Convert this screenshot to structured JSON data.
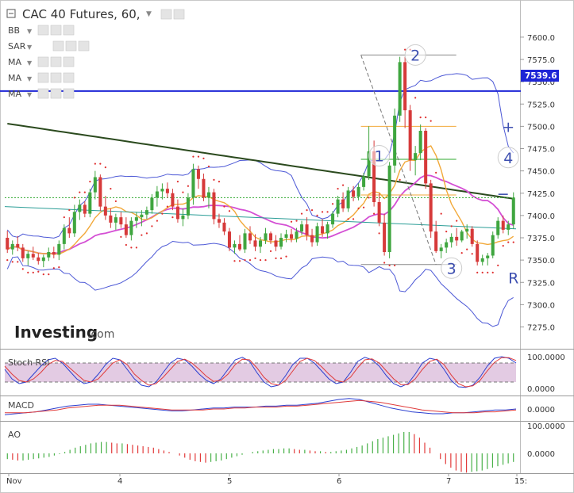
{
  "title": "CAC 40 Futures, 60,",
  "indicators": [
    "BB",
    "SAR",
    "MA",
    "MA",
    "MA"
  ],
  "logo": {
    "main": "Investing",
    "suffix": ".com"
  },
  "colors": {
    "up": "#3fa63f",
    "down": "#d63a3a",
    "bb": "#4c58d6",
    "ma_long": "#2b4a1e",
    "ma_mid": "#d44fd4",
    "ma_short": "#f2a93a",
    "hline": "#1d25d6",
    "support": "#2a9d96",
    "sar": "#e03030",
    "stoch_band": "#e3cbe3",
    "macd_line": "#2b3fd0",
    "signal_line": "#e03b3b",
    "ao_up": "#49b149",
    "ao_down": "#e23a3a"
  },
  "chart_data": [
    {
      "type": "candlestick",
      "title": "CAC 40 Futures, 60,",
      "y_ticks": [
        7600.0,
        7575.0,
        7550.0,
        7525.0,
        7500.0,
        7475.0,
        7450.0,
        7425.0,
        7400.0,
        7375.0,
        7350.0,
        7325.0,
        7300.0,
        7275.0
      ],
      "ylim": [
        7255,
        7615
      ],
      "x_ticks": [
        "Nov",
        "4",
        "5",
        "6",
        "7",
        "15:"
      ],
      "horizontal_line": {
        "value": 7539.6,
        "label": "7539.6"
      },
      "annotations": [
        "1",
        "2",
        "3",
        "+",
        "4",
        "−",
        "R"
      ],
      "candles": [
        [
          7375,
          7383,
          7358,
          7362
        ],
        [
          7362,
          7372,
          7356,
          7368
        ],
        [
          7368,
          7377,
          7360,
          7364
        ],
        [
          7364,
          7368,
          7348,
          7352
        ],
        [
          7352,
          7360,
          7344,
          7357
        ],
        [
          7357,
          7365,
          7350,
          7353
        ],
        [
          7353,
          7358,
          7345,
          7349
        ],
        [
          7349,
          7356,
          7342,
          7353
        ],
        [
          7353,
          7364,
          7349,
          7359
        ],
        [
          7359,
          7365,
          7352,
          7356
        ],
        [
          7356,
          7372,
          7350,
          7368
        ],
        [
          7368,
          7390,
          7362,
          7386
        ],
        [
          7386,
          7398,
          7375,
          7380
        ],
        [
          7380,
          7412,
          7376,
          7404
        ],
        [
          7404,
          7418,
          7395,
          7412
        ],
        [
          7412,
          7416,
          7398,
          7402
        ],
        [
          7402,
          7430,
          7398,
          7426
        ],
        [
          7426,
          7450,
          7418,
          7443
        ],
        [
          7443,
          7446,
          7405,
          7410
        ],
        [
          7410,
          7422,
          7395,
          7400
        ],
        [
          7400,
          7408,
          7386,
          7392
        ],
        [
          7392,
          7402,
          7384,
          7398
        ],
        [
          7398,
          7404,
          7386,
          7390
        ],
        [
          7390,
          7398,
          7375,
          7378
        ],
        [
          7378,
          7398,
          7372,
          7394
        ],
        [
          7394,
          7404,
          7386,
          7398
        ],
        [
          7398,
          7406,
          7388,
          7401
        ],
        [
          7401,
          7410,
          7396,
          7406
        ],
        [
          7406,
          7424,
          7402,
          7420
        ],
        [
          7420,
          7433,
          7410,
          7427
        ],
        [
          7427,
          7436,
          7418,
          7430
        ],
        [
          7430,
          7437,
          7420,
          7425
        ],
        [
          7425,
          7430,
          7406,
          7410
        ],
        [
          7410,
          7418,
          7392,
          7396
        ],
        [
          7396,
          7408,
          7388,
          7400
        ],
        [
          7400,
          7425,
          7396,
          7420
        ],
        [
          7420,
          7458,
          7412,
          7452
        ],
        [
          7452,
          7456,
          7430,
          7441
        ],
        [
          7441,
          7447,
          7416,
          7420
        ],
        [
          7420,
          7432,
          7408,
          7426
        ],
        [
          7426,
          7430,
          7390,
          7396
        ],
        [
          7396,
          7402,
          7386,
          7392
        ],
        [
          7392,
          7397,
          7378,
          7382
        ],
        [
          7382,
          7386,
          7360,
          7364
        ],
        [
          7364,
          7372,
          7357,
          7368
        ],
        [
          7368,
          7378,
          7360,
          7362
        ],
        [
          7362,
          7385,
          7358,
          7380
        ],
        [
          7380,
          7388,
          7368,
          7372
        ],
        [
          7372,
          7379,
          7360,
          7365
        ],
        [
          7365,
          7376,
          7358,
          7372
        ],
        [
          7372,
          7386,
          7368,
          7380
        ],
        [
          7380,
          7382,
          7368,
          7372
        ],
        [
          7372,
          7378,
          7360,
          7365
        ],
        [
          7365,
          7380,
          7362,
          7375
        ],
        [
          7375,
          7384,
          7370,
          7379
        ],
        [
          7379,
          7385,
          7370,
          7374
        ],
        [
          7374,
          7386,
          7370,
          7382
        ],
        [
          7382,
          7394,
          7378,
          7390
        ],
        [
          7390,
          7398,
          7372,
          7378
        ],
        [
          7378,
          7385,
          7365,
          7370
        ],
        [
          7370,
          7392,
          7366,
          7388
        ],
        [
          7388,
          7396,
          7376,
          7380
        ],
        [
          7380,
          7393,
          7374,
          7390
        ],
        [
          7390,
          7405,
          7386,
          7402
        ],
        [
          7402,
          7422,
          7398,
          7418
        ],
        [
          7418,
          7426,
          7404,
          7408
        ],
        [
          7408,
          7432,
          7404,
          7428
        ],
        [
          7428,
          7433,
          7416,
          7421
        ],
        [
          7421,
          7436,
          7417,
          7432
        ],
        [
          7432,
          7448,
          7428,
          7444
        ],
        [
          7444,
          7500,
          7440,
          7472
        ],
        [
          7472,
          7484,
          7410,
          7415
        ],
        [
          7415,
          7425,
          7388,
          7392
        ],
        [
          7392,
          7402,
          7355,
          7359
        ],
        [
          7359,
          7460,
          7352,
          7456
        ],
        [
          7456,
          7520,
          7448,
          7512
        ],
        [
          7512,
          7578,
          7505,
          7572
        ],
        [
          7572,
          7578,
          7498,
          7518
        ],
        [
          7518,
          7524,
          7450,
          7462
        ],
        [
          7462,
          7478,
          7445,
          7470
        ],
        [
          7470,
          7502,
          7462,
          7495
        ],
        [
          7495,
          7498,
          7430,
          7436
        ],
        [
          7436,
          7440,
          7375,
          7382
        ],
        [
          7382,
          7394,
          7358,
          7360
        ],
        [
          7360,
          7368,
          7352,
          7364
        ],
        [
          7364,
          7374,
          7358,
          7370
        ],
        [
          7370,
          7380,
          7364,
          7376
        ],
        [
          7376,
          7386,
          7366,
          7372
        ],
        [
          7372,
          7384,
          7370,
          7382
        ],
        [
          7382,
          7390,
          7374,
          7385
        ],
        [
          7385,
          7388,
          7365,
          7368
        ],
        [
          7368,
          7372,
          7344,
          7348
        ],
        [
          7348,
          7356,
          7344,
          7352
        ],
        [
          7352,
          7358,
          7344,
          7355
        ],
        [
          7355,
          7382,
          7352,
          7378
        ],
        [
          7378,
          7398,
          7374,
          7394
        ],
        [
          7394,
          7400,
          7380,
          7384
        ],
        [
          7384,
          7394,
          7378,
          7390
        ],
        [
          7390,
          7426,
          7385,
          7420
        ]
      ]
    },
    {
      "type": "line",
      "title": "Stoch RSI",
      "y_ticks": [
        100.0,
        0.0
      ],
      "ylim": [
        0,
        100
      ],
      "band": [
        20,
        80
      ],
      "series": [
        {
          "name": "K",
          "values": [
            60,
            30,
            15,
            20,
            45,
            70,
            90,
            95,
            80,
            55,
            30,
            15,
            20,
            45,
            75,
            95,
            90,
            60,
            30,
            10,
            5,
            20,
            50,
            80,
            95,
            90,
            70,
            45,
            25,
            15,
            30,
            60,
            90,
            98,
            85,
            50,
            20,
            5,
            10,
            40,
            75,
            95,
            95,
            80,
            55,
            30,
            15,
            20,
            50,
            85,
            98,
            90,
            70,
            40,
            15,
            5,
            15,
            45,
            80,
            95,
            90,
            60,
            25,
            5,
            3,
            10,
            35,
            70,
            95,
            100,
            95,
            80
          ]
        },
        {
          "name": "D",
          "values": [
            70,
            45,
            25,
            20,
            30,
            50,
            75,
            88,
            85,
            65,
            45,
            25,
            20,
            30,
            55,
            80,
            90,
            75,
            45,
            25,
            10,
            15,
            35,
            60,
            85,
            92,
            80,
            60,
            38,
            22,
            25,
            45,
            75,
            92,
            90,
            65,
            35,
            15,
            10,
            25,
            55,
            85,
            95,
            88,
            68,
            45,
            25,
            20,
            35,
            65,
            90,
            93,
            80,
            55,
            30,
            12,
            12,
            30,
            60,
            85,
            92,
            75,
            42,
            15,
            5,
            8,
            25,
            55,
            82,
            97,
            97,
            88
          ]
        }
      ]
    },
    {
      "type": "line",
      "title": "MACD",
      "y_ticks": [
        0.0
      ],
      "series": [
        {
          "name": "MACD",
          "values": [
            -6,
            -5,
            -4,
            -3,
            -1,
            1,
            3,
            4,
            5,
            5,
            4,
            3,
            2,
            1,
            0,
            -1,
            -2,
            -2,
            -1,
            0,
            1,
            1,
            2,
            2,
            2,
            3,
            3,
            4,
            4,
            5,
            6,
            8,
            10,
            11,
            10,
            7,
            4,
            1,
            -1,
            -3,
            -4,
            -5,
            -5,
            -4,
            -4,
            -3,
            -2,
            -1,
            -1,
            0
          ]
        },
        {
          "name": "Signal",
          "values": [
            -4,
            -4,
            -4,
            -3,
            -2,
            -1,
            1,
            2,
            3,
            4,
            4,
            4,
            3,
            2,
            1,
            0,
            -1,
            -1,
            -1,
            -1,
            0,
            0,
            1,
            1,
            2,
            2,
            2,
            3,
            3,
            4,
            5,
            6,
            7,
            8,
            9,
            8,
            7,
            5,
            3,
            1,
            -1,
            -2,
            -3,
            -4,
            -4,
            -4,
            -3,
            -3,
            -2,
            -1
          ]
        }
      ]
    },
    {
      "type": "bar",
      "title": "AO",
      "y_ticks": [
        100.0,
        0.0
      ],
      "values": [
        -8,
        -9,
        -10,
        -10,
        -9,
        -8,
        -7,
        -6,
        -5,
        -3,
        -1,
        2,
        5,
        8,
        10,
        12,
        14,
        15,
        16,
        16,
        15,
        14,
        14,
        13,
        12,
        11,
        10,
        9,
        8,
        6,
        4,
        2,
        0,
        -3,
        -6,
        -9,
        -11,
        -12,
        -13,
        -12,
        -11,
        -10,
        -8,
        -6,
        -4,
        -2,
        0,
        2,
        3,
        4,
        5,
        6,
        6,
        7,
        7,
        6,
        5,
        5,
        4,
        3,
        3,
        2,
        2,
        3,
        4,
        5,
        7,
        9,
        11,
        14,
        17,
        20,
        22,
        24,
        26,
        28,
        30,
        30,
        27,
        22,
        15,
        8,
        0,
        -8,
        -15,
        -20,
        -24,
        -26,
        -27,
        -26,
        -25,
        -24,
        -22,
        -20,
        -18,
        -16,
        -14,
        -12
      ]
    }
  ]
}
